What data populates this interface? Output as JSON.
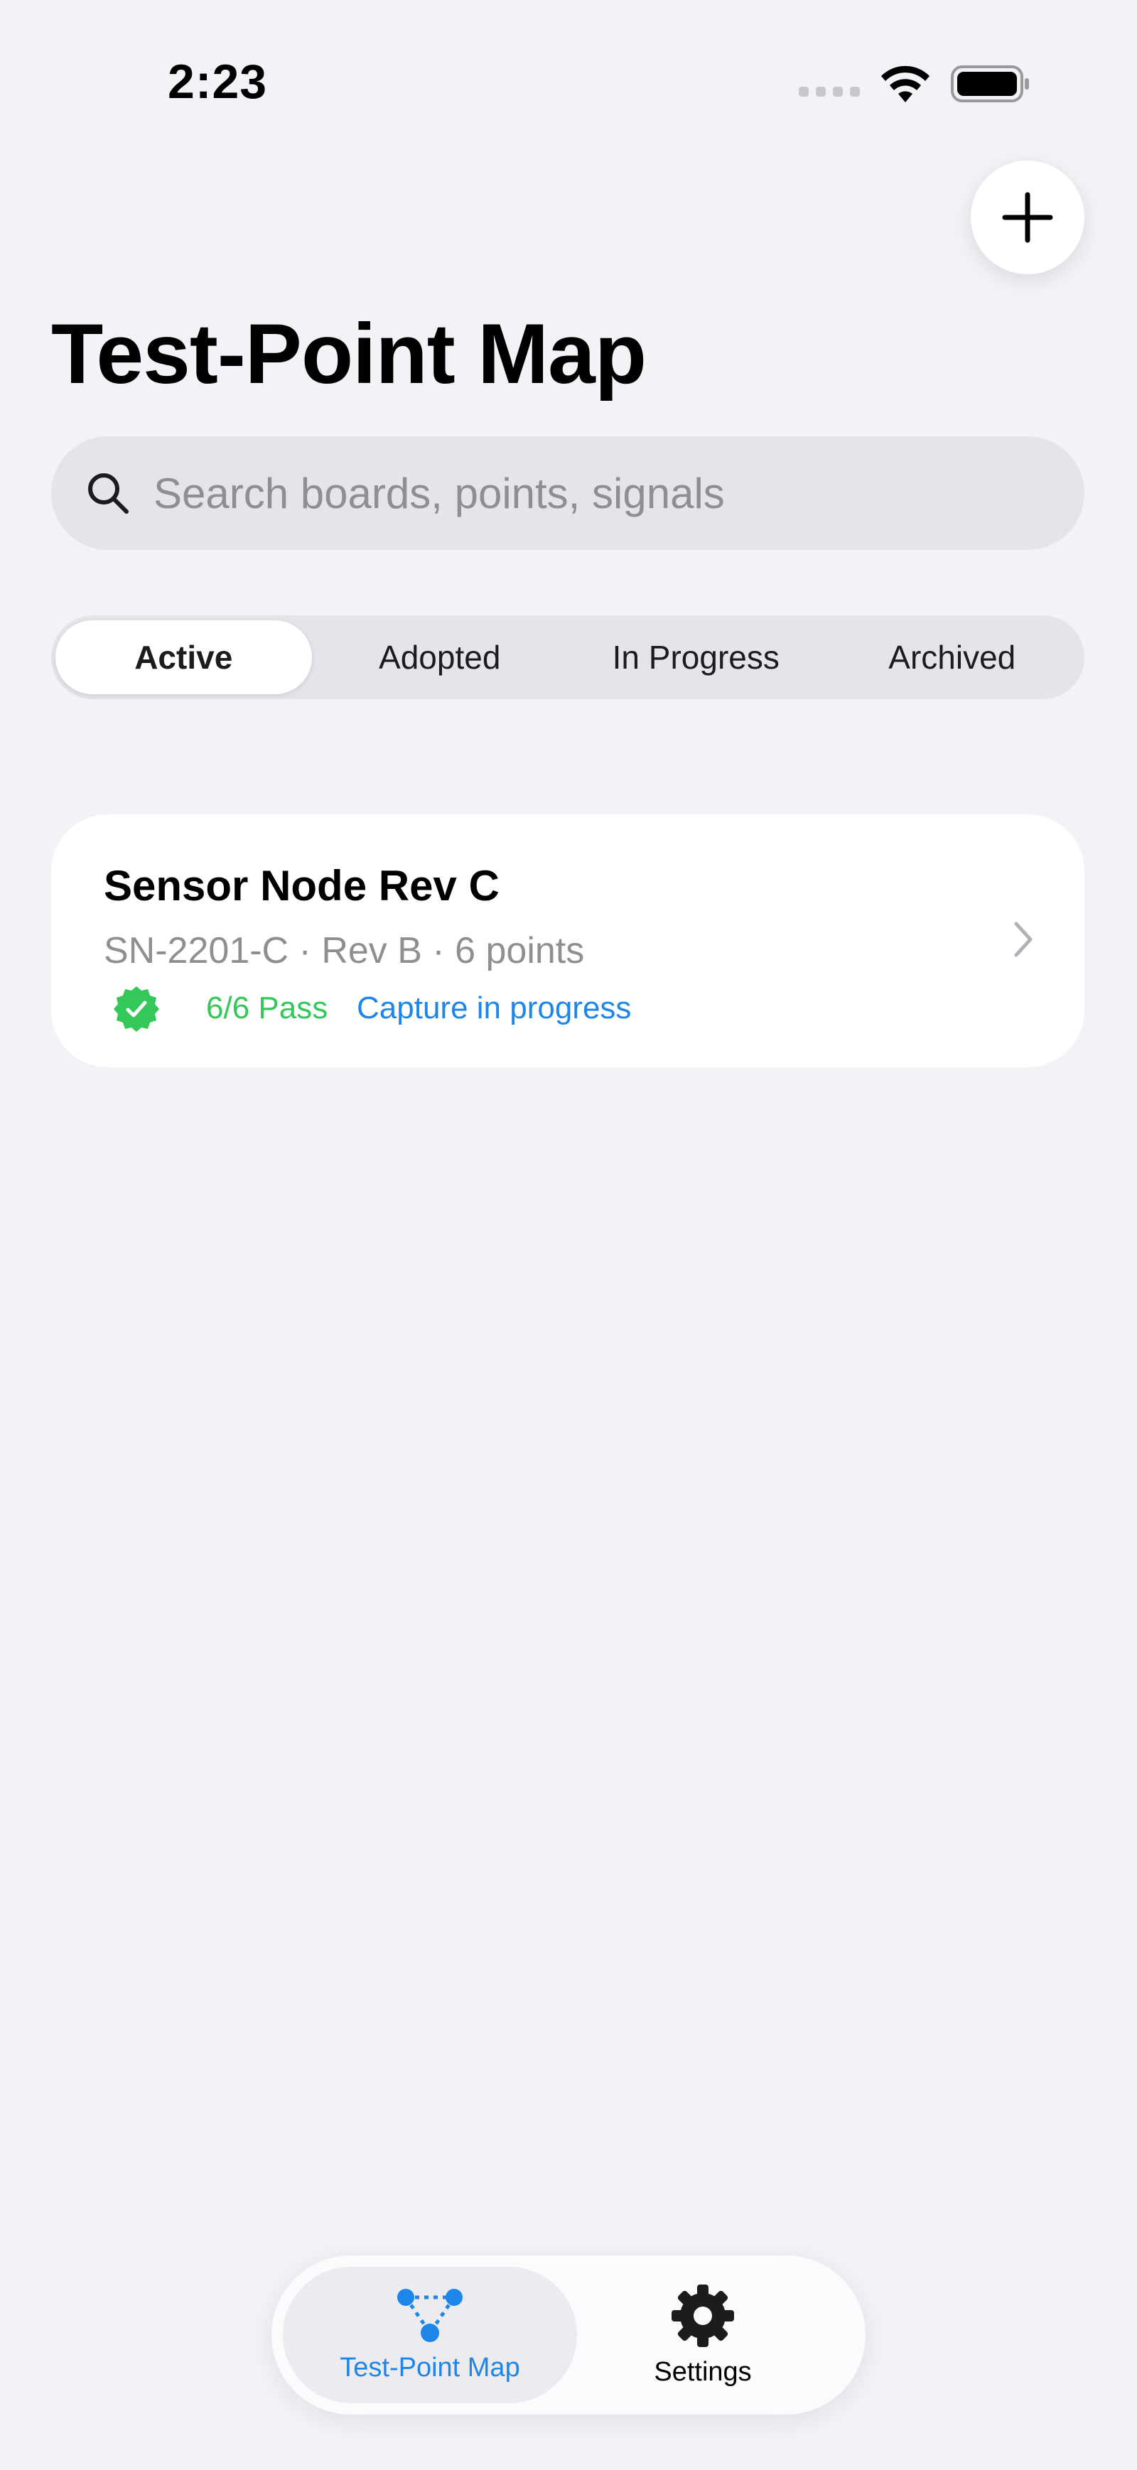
{
  "status_bar": {
    "time": "2:23",
    "icons": [
      "cellular-signal-icon",
      "wifi-icon",
      "battery-icon"
    ]
  },
  "header": {
    "title": "Test-Point Map",
    "add_icon": "plus-icon"
  },
  "search": {
    "placeholder": "Search boards, points, signals",
    "value": "",
    "icon": "search-icon"
  },
  "segments": {
    "items": [
      {
        "label": "Active",
        "selected": true
      },
      {
        "label": "Adopted",
        "selected": false
      },
      {
        "label": "In Progress",
        "selected": false
      },
      {
        "label": "Archived",
        "selected": false
      }
    ]
  },
  "boards": [
    {
      "title": "Sensor Node Rev C",
      "subtitle": "SN-2201-C · Rev B · 6 points",
      "pass_text": "6/6 Pass",
      "status_text": "Capture in progress",
      "badge_icon": "checkmark-seal-icon",
      "chevron_icon": "chevron-right-icon"
    }
  ],
  "tab_bar": {
    "tabs": [
      {
        "label": "Test-Point Map",
        "icon": "test-point-network-icon",
        "selected": true
      },
      {
        "label": "Settings",
        "icon": "gear-icon",
        "selected": false
      }
    ]
  },
  "colors": {
    "background": "#f2f2f7",
    "accent_blue": "#1e86e8",
    "pass_green": "#34c759",
    "secondary_text": "#8e8e93"
  }
}
